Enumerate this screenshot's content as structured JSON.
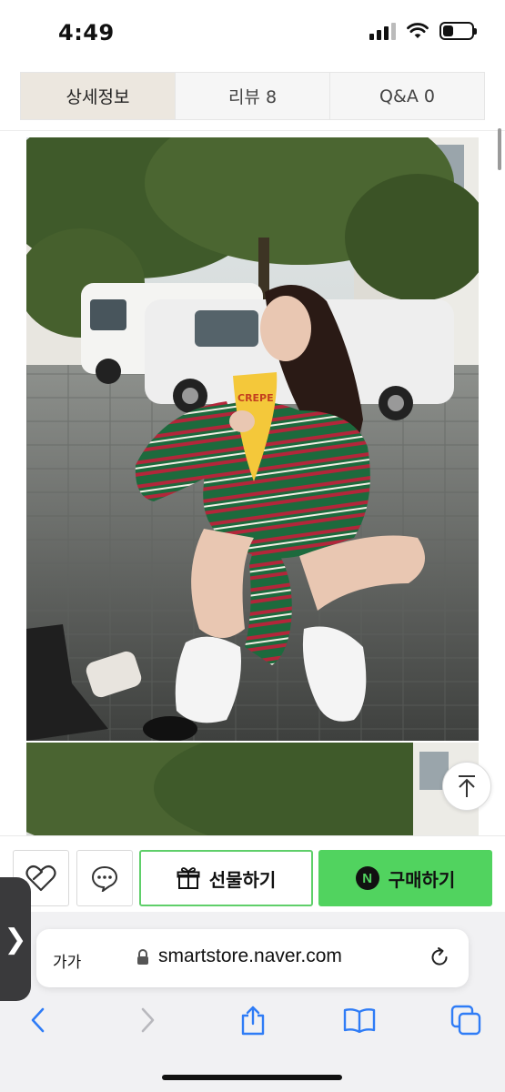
{
  "status_bar": {
    "time": "4:49",
    "battery_level": 0.35
  },
  "tabs": [
    {
      "label": "상세정보",
      "active": true
    },
    {
      "label": "리뷰 8",
      "active": false
    },
    {
      "label": "Q&A 0",
      "active": false
    }
  ],
  "photo": {
    "cup_text": "CREPE"
  },
  "buy_bar": {
    "gift_label": "선물하기",
    "buy_label": "구매하기",
    "buy_badge": "N",
    "accent": "#51d35f"
  },
  "safari": {
    "text_size_label": "가가",
    "url": "smartstore.naver.com",
    "side_handle": "❯"
  },
  "icons": [
    "heart-icon",
    "chat-icon",
    "gift-icon",
    "back-to-top-icon",
    "lock-icon",
    "reload-icon",
    "back-icon",
    "forward-icon",
    "share-icon",
    "bookmarks-icon",
    "tabs-icon"
  ]
}
